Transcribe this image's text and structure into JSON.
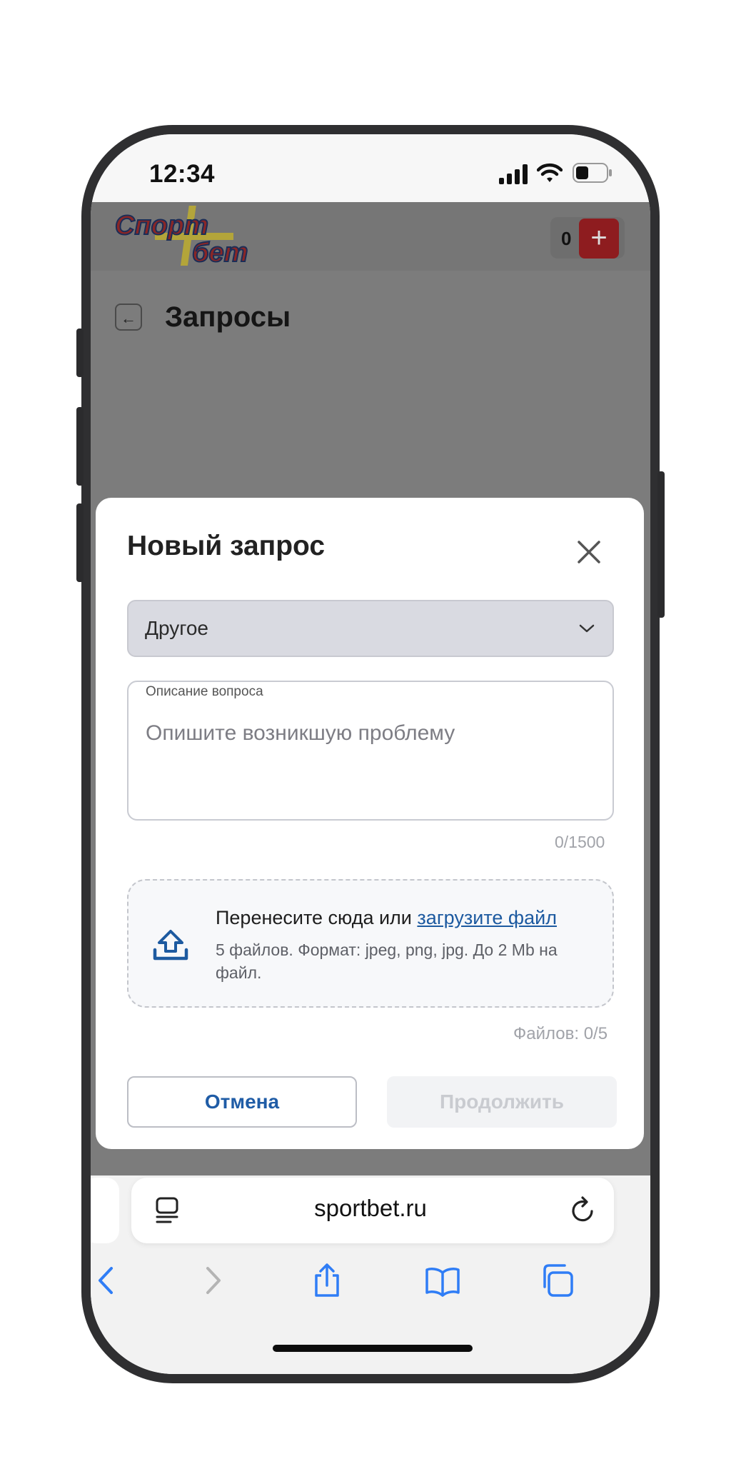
{
  "status_bar": {
    "time": "12:34"
  },
  "site": {
    "logo_alt": "Спорт бет",
    "balance": "0",
    "plus_symbol": "+",
    "back_symbol": "←",
    "page_title": "Запросы"
  },
  "modal": {
    "title": "Новый запрос",
    "category_select": {
      "value": "Другое"
    },
    "description": {
      "label": "Описание вопроса",
      "placeholder": "Опишите возникшую проблему",
      "counter": "0/1500"
    },
    "upload": {
      "text": "Перенесите сюда или",
      "link": "загрузите файл",
      "hint": "5 файлов. Формат: jpeg, png, jpg. До 2 Mb на файл."
    },
    "files_count": "Файлов: 0/5",
    "cancel_label": "Отмена",
    "continue_label": "Продолжить"
  },
  "browser": {
    "url": "sportbet.ru",
    "accent_color": "#2f7df6"
  }
}
